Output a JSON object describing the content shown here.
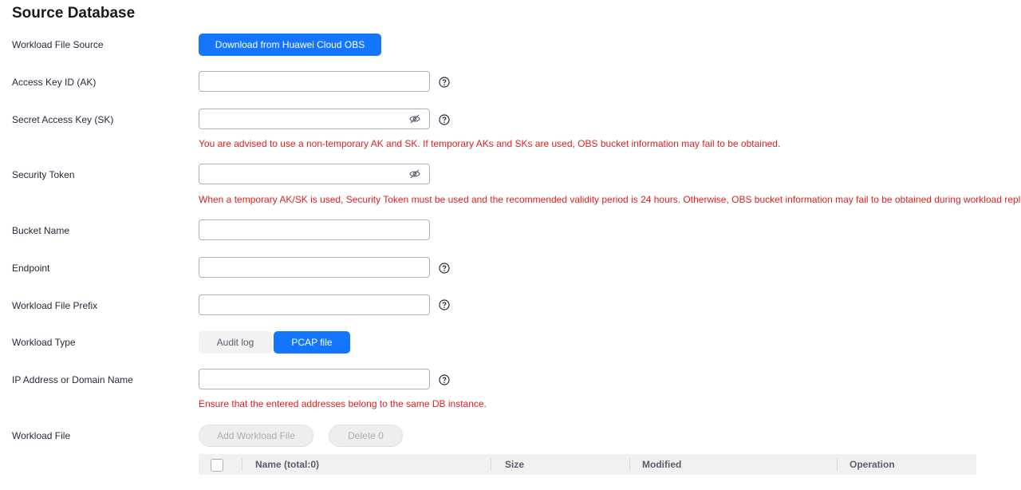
{
  "page": {
    "title": "Source Database"
  },
  "fields": {
    "workload_file_source": {
      "label": "Workload File Source",
      "button": "Download from Huawei Cloud OBS"
    },
    "access_key_id": {
      "label": "Access Key ID (AK)",
      "value": ""
    },
    "secret_access_key": {
      "label": "Secret Access Key (SK)",
      "value": "",
      "warning": "You are advised to use a non-temporary AK and SK. If temporary AKs and SKs are used, OBS bucket information may fail to be obtained."
    },
    "security_token": {
      "label": "Security Token",
      "value": "",
      "warning": "When a temporary AK/SK is used, Security Token must be used and the recommended validity period is 24 hours. Otherwise, OBS bucket information may fail to be obtained during workload replay."
    },
    "bucket_name": {
      "label": "Bucket Name",
      "value": ""
    },
    "endpoint": {
      "label": "Endpoint",
      "value": ""
    },
    "workload_file_prefix": {
      "label": "Workload File Prefix",
      "value": ""
    },
    "workload_type": {
      "label": "Workload Type",
      "options": [
        "Audit log",
        "PCAP file"
      ],
      "selected": "PCAP file"
    },
    "ip_address": {
      "label": "IP Address or Domain Name",
      "value": "",
      "warning": "Ensure that the entered addresses belong to the same DB instance."
    },
    "workload_file": {
      "label": "Workload File",
      "add_button": "Add Workload File",
      "delete_button": "Delete 0"
    }
  },
  "table": {
    "columns": [
      "Name (total:0)",
      "Size",
      "Modified",
      "Operation"
    ],
    "rows": []
  },
  "colors": {
    "primary": "#1476ff",
    "warning": "#e02020"
  },
  "icons": {
    "help": "help-circle-icon",
    "eye": "eye-hidden-icon"
  }
}
